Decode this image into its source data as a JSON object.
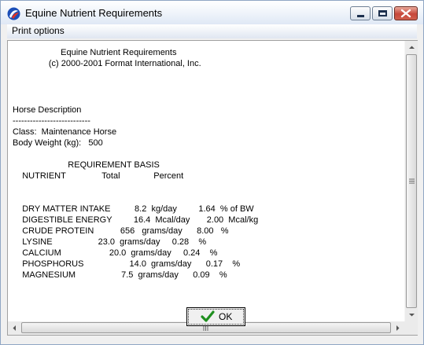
{
  "window": {
    "title": "Equine Nutrient Requirements",
    "icon": "app-logo-icon"
  },
  "menu": {
    "items": [
      "Print options"
    ]
  },
  "report": {
    "lines": [
      "                    Equine Nutrient Requirements",
      "               (c) 2000-2001 Format International, Inc.",
      "",
      "",
      "",
      "Horse Description",
      "---------------------------",
      "Class:  Maintenance Horse",
      "Body Weight (kg):   500",
      "",
      "                       REQUIREMENT BASIS",
      "    NUTRIENT               Total              Percent",
      "",
      "",
      "    DRY MATTER INTAKE          8.2  kg/day         1.64  % of BW",
      "    DIGESTIBLE ENERGY         16.4  Mcal/day       2.00  Mcal/kg",
      "    CRUDE PROTEIN           656   grams/day      8.00   %",
      "    LYSINE                   23.0  grams/day     0.28    %",
      "    CALCIUM                    20.0  grams/day     0.24    %",
      "    PHOSPHORUS                   14.0  grams/day      0.17    %",
      "    MAGNESIUM                   7.5  grams/day      0.09    %"
    ]
  },
  "buttons": {
    "ok_label": "OK"
  }
}
